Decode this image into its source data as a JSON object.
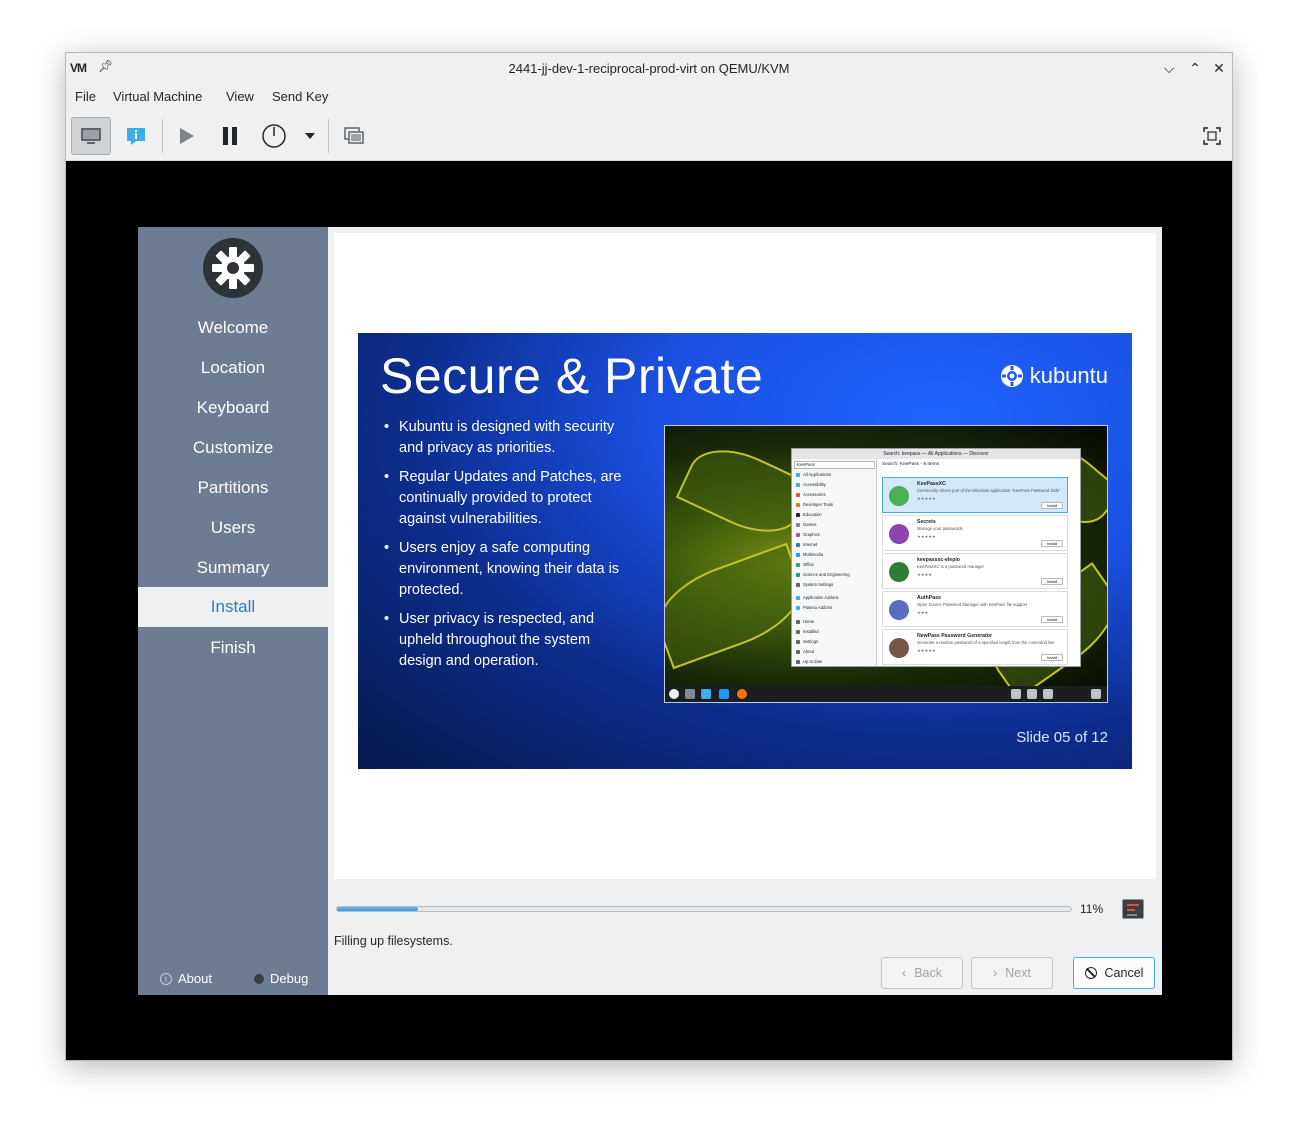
{
  "window": {
    "app_logo": "VM",
    "title": "2441-jj-dev-1-reciprocal-prod-virt on QEMU/KVM"
  },
  "menubar": {
    "items": [
      "File",
      "Virtual Machine",
      "View",
      "Send Key"
    ]
  },
  "toolbar": {
    "buttons": [
      "console-icon",
      "info-icon",
      "play-icon",
      "pause-icon",
      "power-icon",
      "dropdown-icon",
      "snapshots-icon",
      "fullscreen-icon"
    ]
  },
  "installer": {
    "steps": [
      "Welcome",
      "Location",
      "Keyboard",
      "Customize",
      "Partitions",
      "Users",
      "Summary",
      "Install",
      "Finish"
    ],
    "current_step": "Install",
    "footer": {
      "about": "About",
      "debug": "Debug"
    },
    "slide": {
      "title": "Secure & Private",
      "brand": "kubuntu",
      "bullets": [
        "Kubuntu is designed with security and privacy as priorities.",
        "Regular Updates and Patches, are continually provided to protect against vulnerabilities.",
        "Users enjoy a safe computing environment, knowing their data is protected.",
        "User privacy is respected, and upheld throughout the system design and operation."
      ],
      "counter": "Slide 05 of 12",
      "screenshot": {
        "window_title": "Search: keepass — All Applications — Discover",
        "search_value": "KeePass",
        "results_header": "Search: KeePass - 9 Items",
        "categories": [
          "All Applications",
          "Accessibility",
          "Accessories",
          "Developer Tools",
          "Education",
          "Games",
          "Graphics",
          "Internet",
          "Multimedia",
          "Office",
          "Science and Engineering",
          "System Settings",
          "Application Addons",
          "Plasma Addons",
          "Home",
          "Installed",
          "Settings",
          "About",
          "Up to date"
        ],
        "apps": [
          {
            "name": "KeePassXC",
            "desc": "Community-driven port of the Windows application \"KeePass Password Safe\"",
            "button": "Install"
          },
          {
            "name": "Secrets",
            "desc": "Manage your passwords",
            "button": "Install"
          },
          {
            "name": "keepassxc-elepio",
            "desc": "KeePassXC is a password manager",
            "button": "Install"
          },
          {
            "name": "AuthPass",
            "desc": "Open Source Password Manager with KeePass file support",
            "button": "Install"
          },
          {
            "name": "NewPass Password Generator",
            "desc": "Generate a random password of a specified length from the command line",
            "button": "Install"
          }
        ]
      }
    },
    "progress": {
      "value": 0.11,
      "label": "11%"
    },
    "status": "Filling up filesystems.",
    "buttons": {
      "back": "Back",
      "next": "Next",
      "cancel": "Cancel"
    }
  },
  "colors": {
    "sidebar": "#6e7c93",
    "accent": "#2980b9",
    "slide_blue": "#1a4fe0",
    "progress": "#3d98e0"
  }
}
